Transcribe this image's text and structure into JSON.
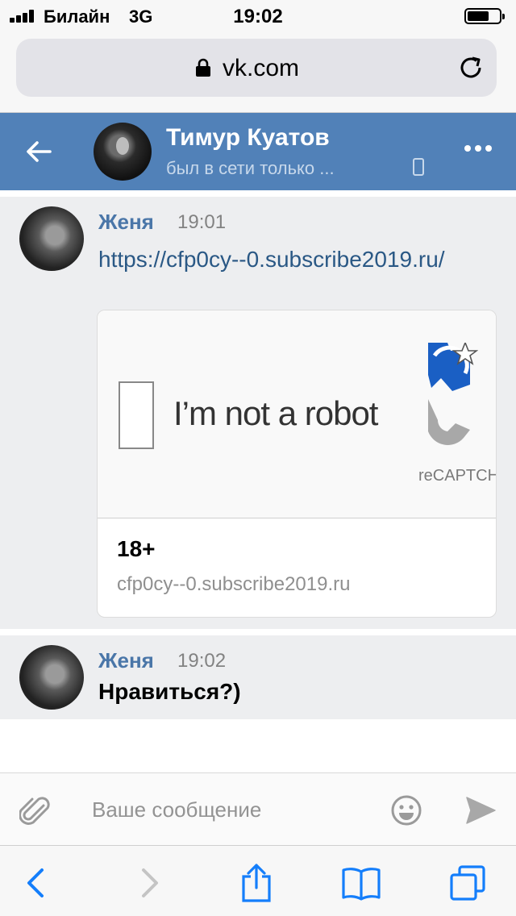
{
  "status_bar": {
    "carrier": "Билайн",
    "network": "3G",
    "time": "19:02"
  },
  "browser": {
    "url": "vk.com",
    "icons": [
      "lock-icon",
      "reload-icon"
    ]
  },
  "header": {
    "name": "Тимур Куатов",
    "status": "был в сети только ...",
    "icons": [
      "back-arrow-icon",
      "mobile-phone-icon",
      "more-dots-icon"
    ]
  },
  "messages": [
    {
      "author": "Женя",
      "time": "19:01",
      "link": "https://cfp0cy--0.subscribe2019.ru/",
      "preview": {
        "captcha_text": "I’m not a robot",
        "captcha_brand": "reCAPTCHA",
        "title": "18+",
        "domain": "cfp0cy--0.subscribe2019.ru"
      }
    },
    {
      "author": "Женя",
      "time": "19:02",
      "text": "Нравиться?)"
    }
  ],
  "composer": {
    "placeholder": "Ваше сообщение",
    "icons": [
      "paperclip-icon",
      "smiley-icon",
      "send-icon"
    ]
  },
  "toolbar": {
    "icons": [
      "back-icon",
      "forward-icon",
      "share-icon",
      "bookmarks-icon",
      "tabs-icon"
    ]
  },
  "colors": {
    "vk_header": "#5181b8",
    "link": "#2a5885",
    "author": "#4a76a8",
    "ios_blue": "#147efb"
  }
}
